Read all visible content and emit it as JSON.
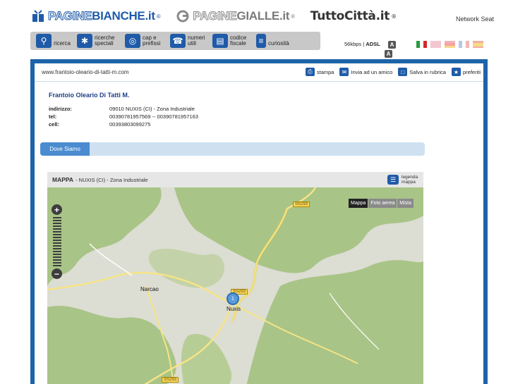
{
  "header": {
    "logo_paginebianche_outline": "PAGINE",
    "logo_paginebianche_main": "BIANCHE.it",
    "logo_paginegialle_outline": "PAGINE",
    "logo_paginegialle_main": "GIALLE.it",
    "logo_tuttocitta": "TuttoCittà.it",
    "registered": "®",
    "network": "Network Seat"
  },
  "toolbar": {
    "items": [
      {
        "label": "ricerca",
        "icon": "search-icon"
      },
      {
        "label": "ricerche speciali",
        "icon": "puzzle-icon"
      },
      {
        "label": "cap e prefissi",
        "icon": "globe-icon"
      },
      {
        "label": "numeri utili",
        "icon": "phone-icon"
      },
      {
        "label": "codice fiscale",
        "icon": "card-icon"
      },
      {
        "label": "curiosità",
        "icon": "grid-icon"
      }
    ],
    "speed_label": "56kbps",
    "adsl_label": "ADSL",
    "badge": "A"
  },
  "url": "www.frantoio-oleario-di-tatti-m.com",
  "actions": [
    {
      "label": "stampa",
      "icon": "print-icon"
    },
    {
      "label": "Invia ad un amico",
      "icon": "mail-icon"
    },
    {
      "label": "Salva in rubrica",
      "icon": "folder-icon"
    },
    {
      "label": "preferiti",
      "icon": "star-icon"
    }
  ],
  "business": {
    "name": "Frantoio Oleario Di Tatti M.",
    "address_key": "indirizzo:",
    "address": "09010 NUXIS (CI) - Zona Industriale",
    "tel_key": "tel:",
    "tel": "00390781957569 -- 00390781957163",
    "cell_key": "cell:",
    "cell": "00393803099275"
  },
  "tabs": {
    "active": "Dove Siamo"
  },
  "map": {
    "title": "MAPPA",
    "subtitle": "- NUXIS (CI) - Zona Industriale",
    "legend": "legenda mappa",
    "types": [
      "Mappa",
      "Foto aerea",
      "Mista"
    ],
    "places": [
      "Narcao",
      "Nuxis"
    ],
    "roads": [
      "SS293",
      "SS293",
      "SS293"
    ],
    "pin_label": "1",
    "colors": {
      "forest": "#a9c487",
      "clear": "#dcddd3",
      "road": "#f6e486"
    }
  }
}
